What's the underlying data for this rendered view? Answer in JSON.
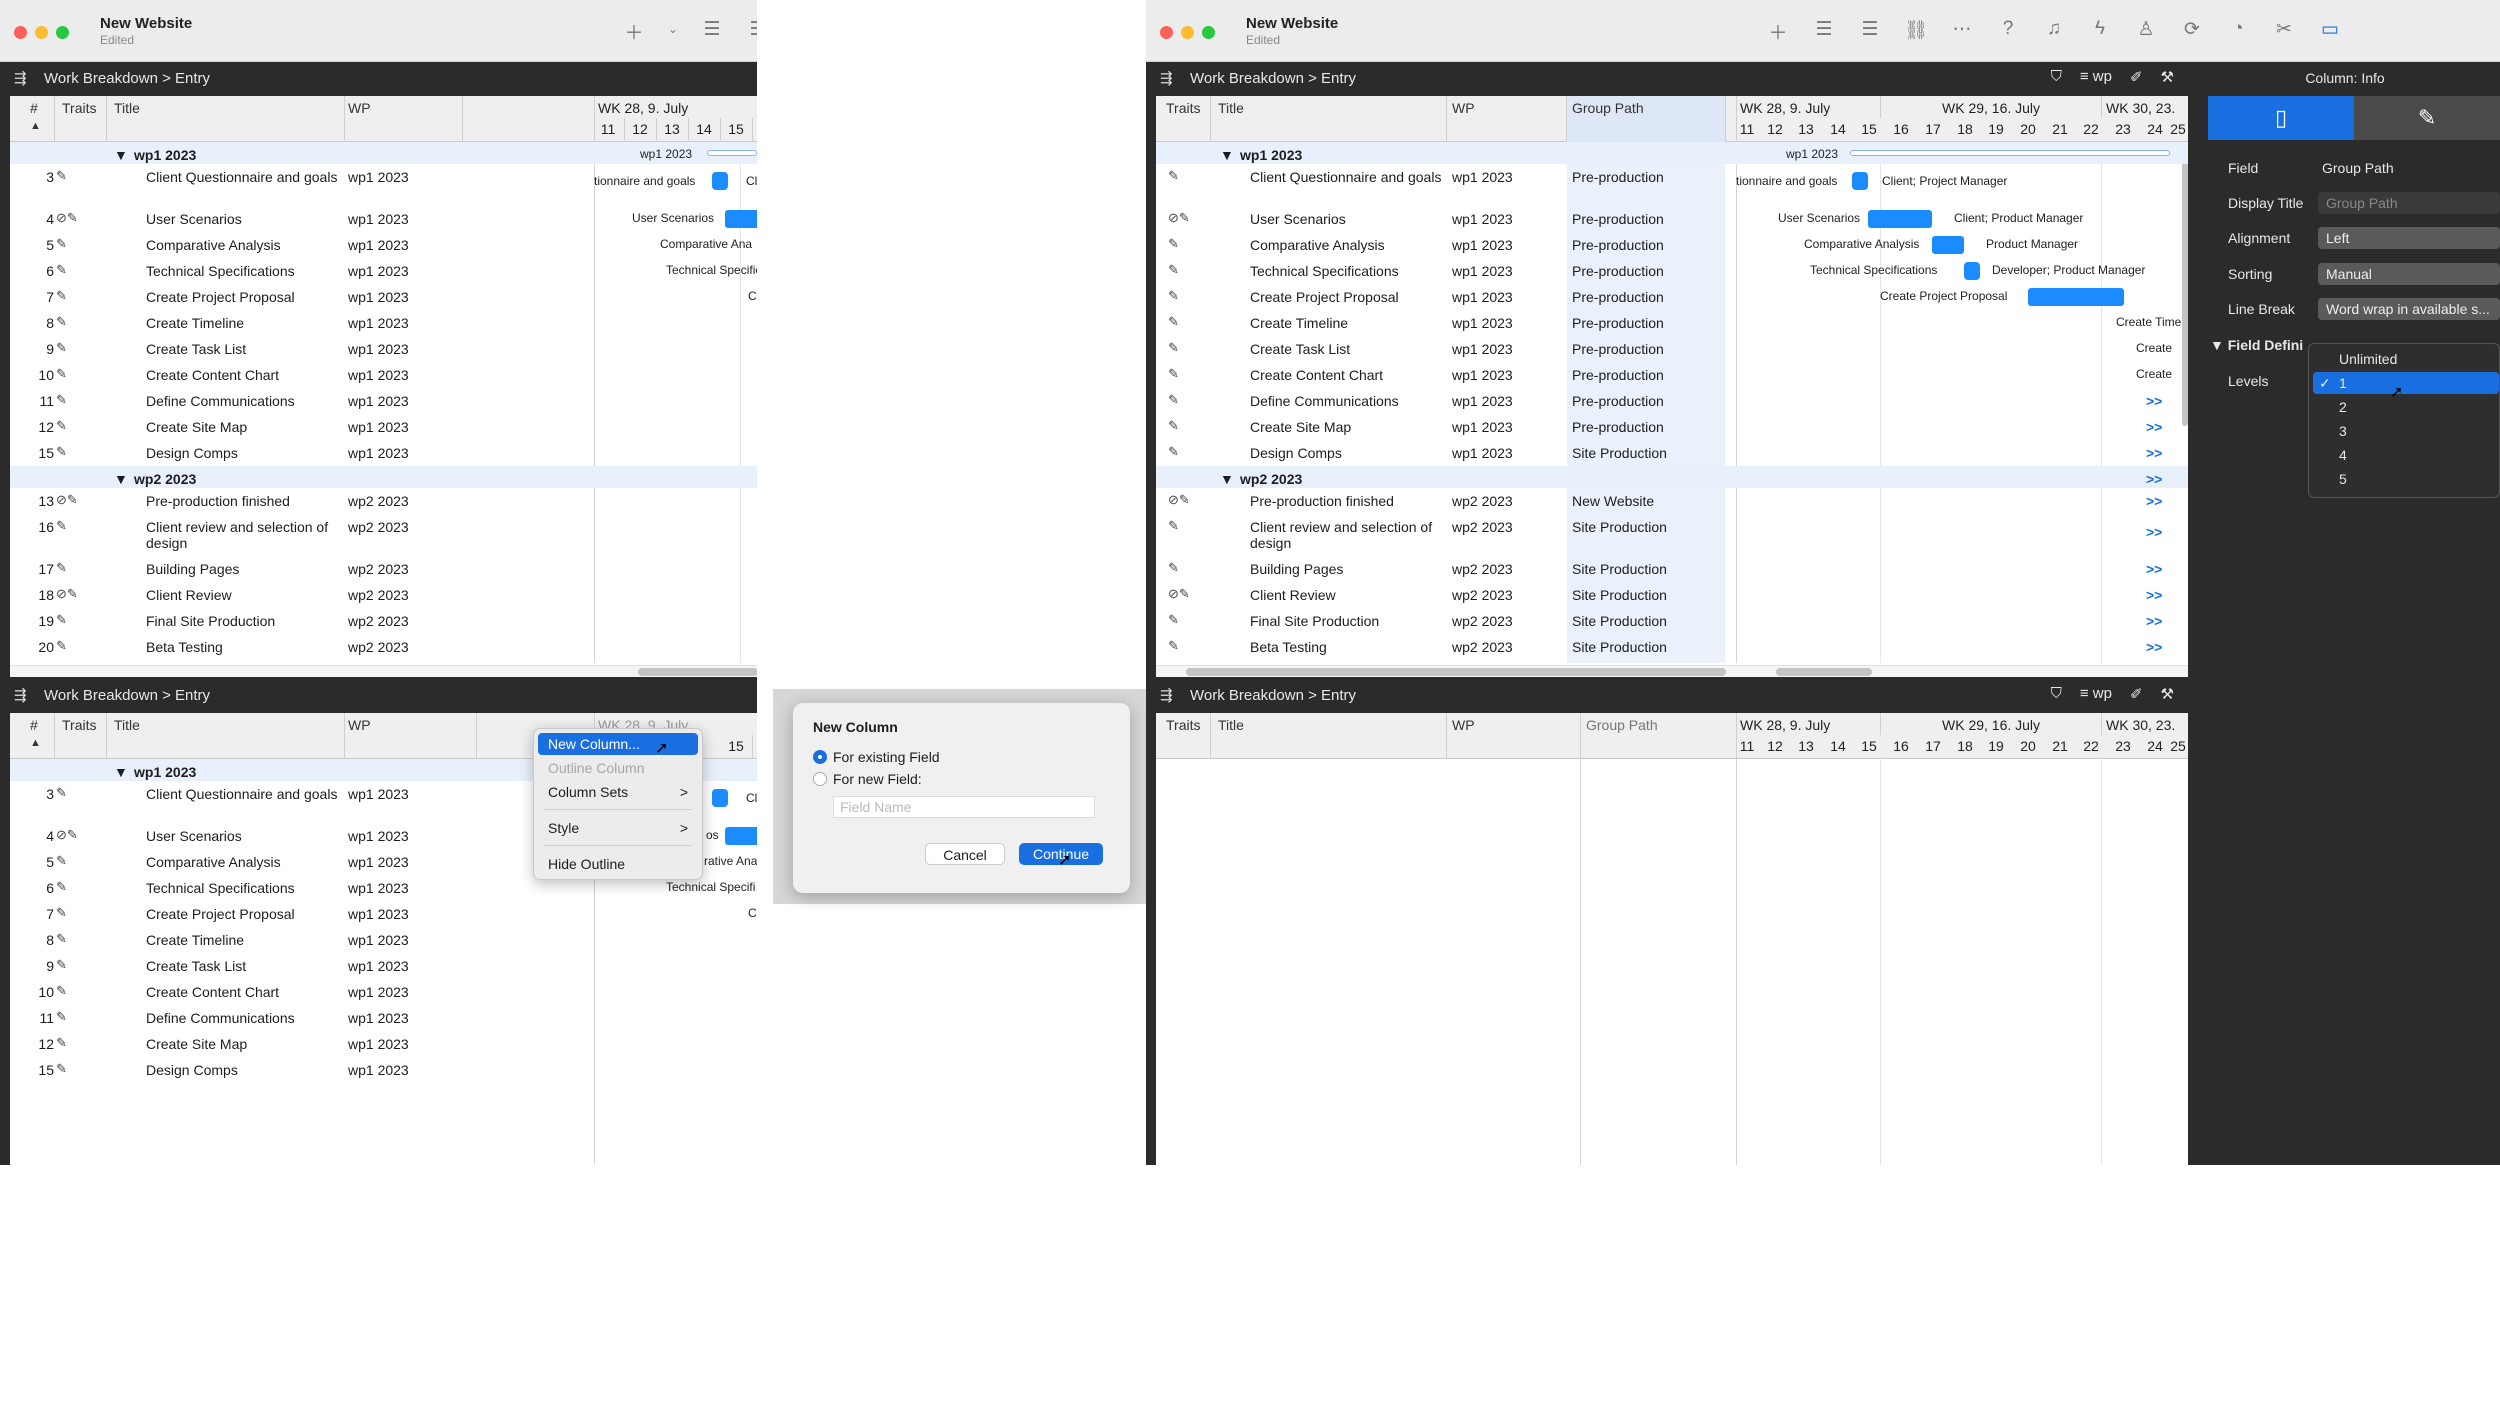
{
  "window": {
    "title": "New Website",
    "subtitle": "Edited"
  },
  "breadcrumb": {
    "root": "Work Breakdown",
    "sep": ">",
    "leaf": "Entry"
  },
  "filter_wp": "wp",
  "columns": {
    "num": "#",
    "traits": "Traits",
    "title": "Title",
    "wp": "WP",
    "group_path": "Group Path"
  },
  "weeks": [
    "WK 28, 9. July",
    "WK 29, 16. July",
    "WK 30, 23."
  ],
  "week_short": "WK 28, 9. July",
  "days": [
    "11",
    "12",
    "13",
    "14",
    "15",
    "16",
    "17",
    "18",
    "19",
    "20",
    "21",
    "22",
    "23",
    "24",
    "25"
  ],
  "groups": {
    "wp1": "wp1 2023",
    "wp2": "wp2 2023"
  },
  "rows_wp1": [
    {
      "num": "3",
      "title": "Client Questionnaire and goals",
      "wp": "wp1 2023",
      "gp": "Pre-production"
    },
    {
      "num": "4",
      "title": "User Scenarios",
      "wp": "wp1 2023",
      "gp": "Pre-production"
    },
    {
      "num": "5",
      "title": "Comparative Analysis",
      "wp": "wp1 2023",
      "gp": "Pre-production"
    },
    {
      "num": "6",
      "title": "Technical Specifications",
      "wp": "wp1 2023",
      "gp": "Pre-production"
    },
    {
      "num": "7",
      "title": "Create Project Proposal",
      "wp": "wp1 2023",
      "gp": "Pre-production"
    },
    {
      "num": "8",
      "title": "Create Timeline",
      "wp": "wp1 2023",
      "gp": "Pre-production"
    },
    {
      "num": "9",
      "title": "Create Task List",
      "wp": "wp1 2023",
      "gp": "Pre-production"
    },
    {
      "num": "10",
      "title": "Create Content Chart",
      "wp": "wp1 2023",
      "gp": "Pre-production"
    },
    {
      "num": "11",
      "title": "Define Communications",
      "wp": "wp1 2023",
      "gp": "Pre-production"
    },
    {
      "num": "12",
      "title": "Create Site Map",
      "wp": "wp1 2023",
      "gp": "Pre-production"
    },
    {
      "num": "15",
      "title": "Design Comps",
      "wp": "wp1 2023",
      "gp": "Site Production"
    }
  ],
  "rows_wp2": [
    {
      "num": "13",
      "title": "Pre-production finished",
      "wp": "wp2 2023",
      "gp": "New Website"
    },
    {
      "num": "16",
      "title": "Client review and selection of design",
      "wp": "wp2 2023",
      "gp": "Site Production"
    },
    {
      "num": "17",
      "title": "Building Pages",
      "wp": "wp2 2023",
      "gp": "Site Production"
    },
    {
      "num": "18",
      "title": "Client Review",
      "wp": "wp2 2023",
      "gp": "Site Production"
    },
    {
      "num": "19",
      "title": "Final Site Production",
      "wp": "wp2 2023",
      "gp": "Site Production"
    },
    {
      "num": "20",
      "title": "Beta Testing",
      "wp": "wp2 2023",
      "gp": "Site Production"
    }
  ],
  "gantt_left": {
    "g_wp1": "wp1 2023",
    "l1": "tionnaire and goals",
    "l1b": "Cl",
    "l2": "User Scenarios",
    "l3": "Comparative Ana",
    "l4": "Technical Specific",
    "l5": "C"
  },
  "gantt_right": {
    "g_wp1": "wp1 2023",
    "l1": "tionnaire and goals",
    "r1": "Client; Project Manager",
    "l2": "User Scenarios",
    "r2": "Client; Product Manager",
    "l3": "Comparative Analysis",
    "r3": "Product Manager",
    "l4": "Technical Specifications",
    "r4": "Developer; Product Manager",
    "l5": "Create Project Proposal",
    "l6": "Create Time",
    "l7": "Create",
    "l8": "Create",
    "more": ">>"
  },
  "gantt_bottom": {
    "l1b": "Cl",
    "l2": "os",
    "l3": "rative Ana",
    "l4": "Technical Specifi",
    "l5": "C"
  },
  "context_menu": {
    "new_column": "New Column...",
    "outline_column": "Outline Column",
    "column_sets": "Column Sets",
    "style": "Style",
    "hide_outline": "Hide Outline",
    "arrow": ">"
  },
  "dialog": {
    "title": "New Column",
    "opt_existing": "For existing Field",
    "opt_new": "For new Field:",
    "field_placeholder": "Field Name",
    "cancel": "Cancel",
    "continue": "Continue"
  },
  "inspector": {
    "header": "Column: Info",
    "field_label": "Field",
    "field_value": "Group Path",
    "display_title_label": "Display Title",
    "display_title_placeholder": "Group Path",
    "alignment_label": "Alignment",
    "alignment_value": "Left",
    "sorting_label": "Sorting",
    "sorting_value": "Manual",
    "line_break_label": "Line Break",
    "line_break_value": "Word wrap in available s...",
    "section": "Field Defini",
    "levels_label": "Levels"
  },
  "levels_dropdown": {
    "options": [
      "Unlimited",
      "1",
      "2",
      "3",
      "4",
      "5"
    ],
    "selected": "1",
    "check": "✓"
  }
}
